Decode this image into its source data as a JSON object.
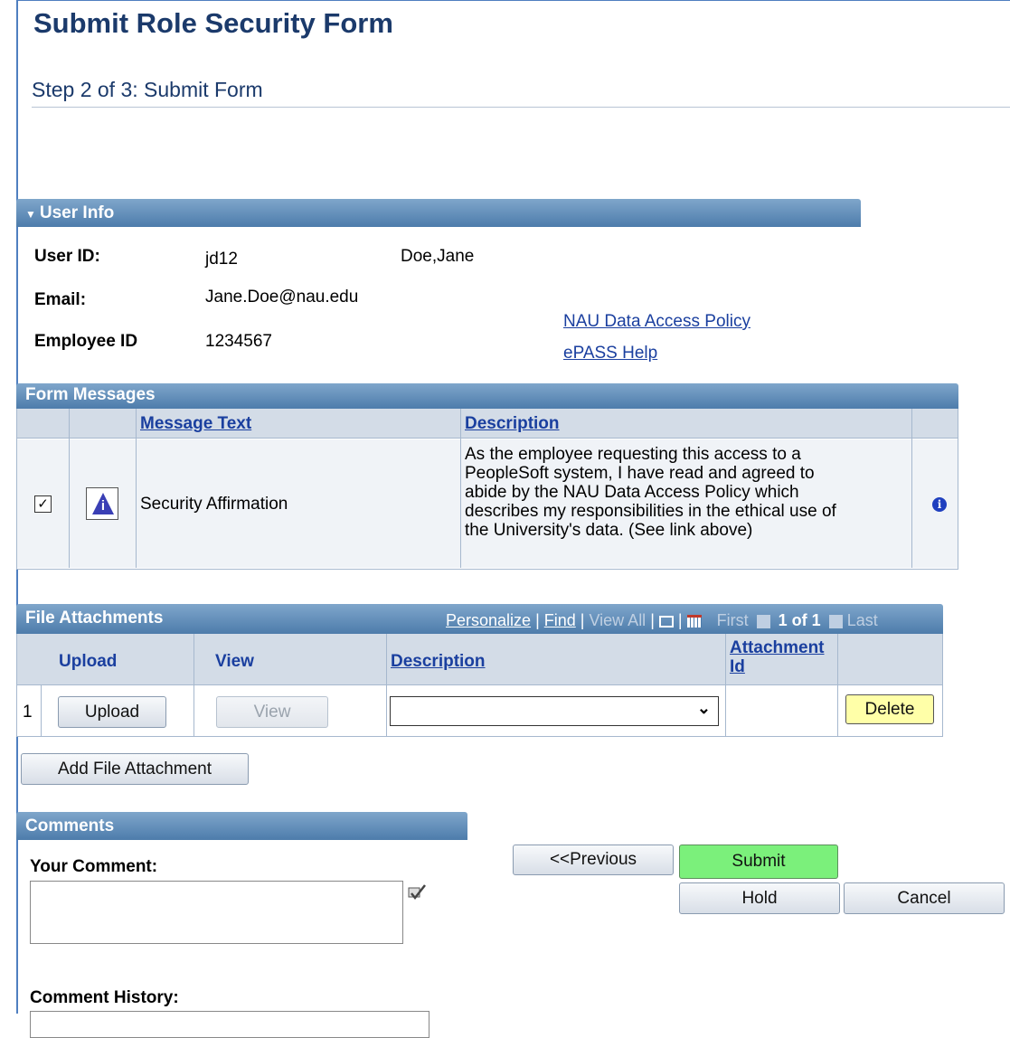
{
  "page": {
    "title": "Submit Role Security Form",
    "step": "Step 2 of 3: Submit Form"
  },
  "user_info": {
    "header": "User Info",
    "user_id_label": "User ID:",
    "user_id": "jd12",
    "name": "Doe,Jane",
    "email_label": "Email:",
    "email": "Jane.Doe@nau.edu",
    "employee_id_label": "Employee ID",
    "employee_id": "1234567",
    "links": [
      "NAU Data Access Policy",
      "ePASS Help"
    ]
  },
  "form_messages": {
    "header": "Form Messages",
    "columns": [
      "Message Text",
      "Description"
    ],
    "rows": [
      {
        "checked": true,
        "message_text": "Security Affirmation",
        "description_lines": [
          "As the employee requesting this access to a",
          "PeopleSoft system, I have read and agreed to",
          "abide by the NAU Data Access Policy which",
          "describes my responsibilities in the ethical use of",
          "the University's data. (See link above)"
        ]
      }
    ]
  },
  "file_attachments": {
    "header": "File Attachments",
    "nav": {
      "personalize": "Personalize",
      "find": "Find",
      "view_all": "View All",
      "first": "First",
      "counter": "1 of 1",
      "last": "Last"
    },
    "columns": [
      "Upload",
      "View",
      "Description",
      "Attachment Id"
    ],
    "column_attachment_line1": "Attachment",
    "column_attachment_line2": "Id",
    "rows": [
      {
        "index": "1",
        "upload_label": "Upload",
        "view_label": "View",
        "description_value": "",
        "attachment_id": "",
        "delete_label": "Delete"
      }
    ],
    "add_button": "Add File Attachment"
  },
  "comments": {
    "header": "Comments",
    "your_comment_label": "Your Comment:",
    "your_comment_value": "",
    "history_label": "Comment History:",
    "history_value": ""
  },
  "actions": {
    "previous": "<<Previous",
    "submit": "Submit",
    "hold": "Hold",
    "cancel": "Cancel"
  },
  "colors": {
    "title": "#1b3a6b",
    "link": "#1a3f9f",
    "bar": "#4d7cab",
    "submit": "#7bf07b",
    "delete": "#ffffa8"
  }
}
